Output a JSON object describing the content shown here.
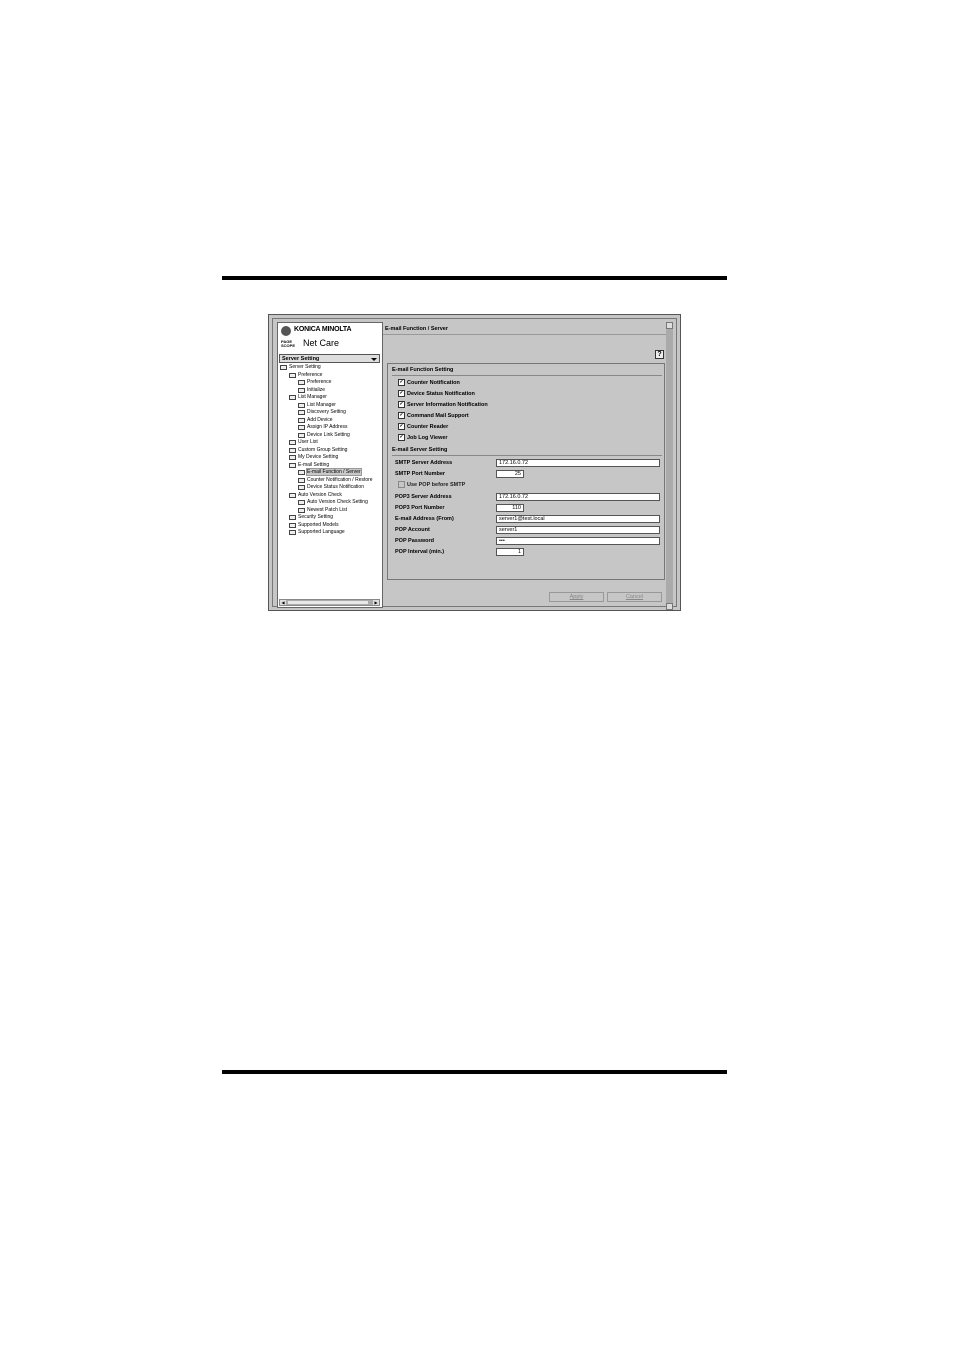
{
  "app": {
    "brand": "KONICA MINOLTA",
    "product_prefix": "PAGE SCOPE",
    "product": "Net Care",
    "nav_select_value": "Server Setting"
  },
  "tree": [
    {
      "label": "Server Setting",
      "level": 0,
      "icon": "folder-icon"
    },
    {
      "label": "Preference",
      "level": 1,
      "icon": "folder-icon"
    },
    {
      "label": "Preference",
      "level": 2,
      "icon": "window-icon"
    },
    {
      "label": "Initialize",
      "level": 2,
      "icon": "initialize-icon"
    },
    {
      "label": "List Manager",
      "level": 1,
      "icon": "folder-icon"
    },
    {
      "label": "List Manager",
      "level": 2,
      "icon": "window-icon"
    },
    {
      "label": "Discovery Setting",
      "level": 2,
      "icon": "discovery-icon"
    },
    {
      "label": "Add Device",
      "level": 2,
      "icon": "add-device-icon"
    },
    {
      "label": "Assign IP Address",
      "level": 2,
      "icon": "ip-icon"
    },
    {
      "label": "Device Link Setting",
      "level": 2,
      "icon": "link-icon"
    },
    {
      "label": "User List",
      "level": 1,
      "icon": "user-icon"
    },
    {
      "label": "Custom Group Setting",
      "level": 1,
      "icon": "group-icon"
    },
    {
      "label": "My Device Setting",
      "level": 1,
      "icon": "device-icon"
    },
    {
      "label": "E-mail Setting",
      "level": 1,
      "icon": "folder-icon"
    },
    {
      "label": "E-mail Function / Server",
      "level": 2,
      "icon": "window-icon",
      "selected": true
    },
    {
      "label": "Counter Notification / Restore",
      "level": 2,
      "icon": "window-icon"
    },
    {
      "label": "Device Status Notification",
      "level": 2,
      "icon": "window-icon"
    },
    {
      "label": "Auto Version Check",
      "level": 1,
      "icon": "folder-icon"
    },
    {
      "label": "Auto Version Check Setting",
      "level": 2,
      "icon": "window-icon"
    },
    {
      "label": "Newest Patch List",
      "level": 2,
      "icon": "list-icon"
    },
    {
      "label": "Security Setting",
      "level": 1,
      "icon": "security-icon"
    },
    {
      "label": "Supported Models",
      "level": 1,
      "icon": "models-icon"
    },
    {
      "label": "Supported Language",
      "level": 1,
      "icon": "language-icon"
    }
  ],
  "panel": {
    "title": "E-mail Function / Server",
    "help_label": "?",
    "function_section": "E-mail Function Setting",
    "checkboxes": [
      {
        "label": "Counter Notification",
        "checked": true
      },
      {
        "label": "Device Status Notification",
        "checked": true
      },
      {
        "label": "Server Information Notification",
        "checked": true
      },
      {
        "label": "Command Mail Support",
        "checked": true
      },
      {
        "label": "Counter Reader",
        "checked": true
      },
      {
        "label": "Job Log Viewer",
        "checked": true
      }
    ],
    "server_section": "E-mail Server Setting",
    "fields": {
      "smtp_address": {
        "label": "SMTP Server Address",
        "value": "172.16.0.72"
      },
      "smtp_port": {
        "label": "SMTP Port Number",
        "value": "25"
      },
      "use_pop": {
        "label": "Use POP before SMTP",
        "checked": false
      },
      "pop3_address": {
        "label": "POP3 Server Address",
        "value": "172.16.0.72"
      },
      "pop3_port": {
        "label": "POP3 Port Number",
        "value": "110"
      },
      "email_from": {
        "label": "E-mail Address (From)",
        "value": "server1@test.local"
      },
      "pop_account": {
        "label": "POP Account",
        "value": "server1"
      },
      "pop_password": {
        "label": "POP Password",
        "value": "•••"
      },
      "pop_interval": {
        "label": "POP Interval (min.)",
        "value": "1"
      }
    },
    "apply_label": "Apply",
    "cancel_label": "Cancel"
  }
}
